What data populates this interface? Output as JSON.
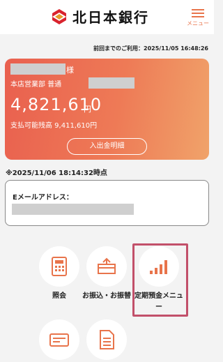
{
  "header": {
    "bank_name": "北日本銀行",
    "menu_label": "メニュー"
  },
  "last_login": "前回までのご利用：2025/11/05 16:48:26",
  "account": {
    "name_suffix": "様",
    "branch": "本店営業部 普通",
    "balance": "4,821,610",
    "currency": "円",
    "available": "支払可能残高 9,411,610円",
    "history_button": "入出金明細"
  },
  "as_of": "※2025/11/06 18:14:32時点",
  "email": {
    "label": "Eメールアドレス："
  },
  "tiles": [
    {
      "label": "照会",
      "icon": "calculator-icon"
    },
    {
      "label": "お振込・お振替",
      "icon": "transfer-icon"
    },
    {
      "label": "定期預金メニュー",
      "icon": "bar-chart-icon"
    },
    {
      "label": "",
      "icon": "card-icon"
    },
    {
      "label": "",
      "icon": "document-icon"
    }
  ],
  "colors": {
    "accent": "#e8744b",
    "highlight": "#c2506a"
  }
}
